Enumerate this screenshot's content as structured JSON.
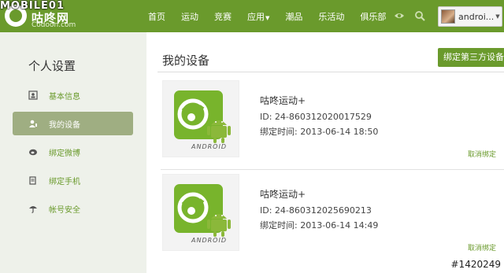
{
  "header": {
    "watermark": "MOBILE01",
    "logo_text": "咕咚网",
    "logo_sub": "Codoon.com",
    "nav": [
      "首页",
      "运动",
      "竞赛",
      "应用",
      "潮品",
      "乐活动",
      "俱乐部"
    ],
    "user_name": "androi..."
  },
  "sidebar": {
    "title": "个人设置",
    "items": [
      {
        "label": "基本信息",
        "icon": "profile-card-icon"
      },
      {
        "label": "我的设备",
        "icon": "user-device-icon"
      },
      {
        "label": "绑定微博",
        "icon": "weibo-icon"
      },
      {
        "label": "绑定手机",
        "icon": "phone-icon"
      },
      {
        "label": "帐号安全",
        "icon": "umbrella-icon"
      }
    ]
  },
  "main": {
    "title": "我的设备",
    "bind_button": "绑定第三方设备",
    "devices": [
      {
        "name": "咕咚运动+",
        "id": "ID: 24-860312020017529",
        "time": "绑定时间: 2013-06-14 18:50",
        "unbind": "取消绑定",
        "badge_text": "ANDROID"
      },
      {
        "name": "咕咚运动+",
        "id": "ID: 24-860312025690213",
        "time": "绑定时间: 2013-06-14 14:49",
        "unbind": "取消绑定",
        "badge_text": "ANDROID"
      }
    ]
  },
  "watermark_id": "#1420249",
  "colors": {
    "brand": "#6a9a2c",
    "active_bg": "#9fae82",
    "app_tile": "#78b42c"
  }
}
